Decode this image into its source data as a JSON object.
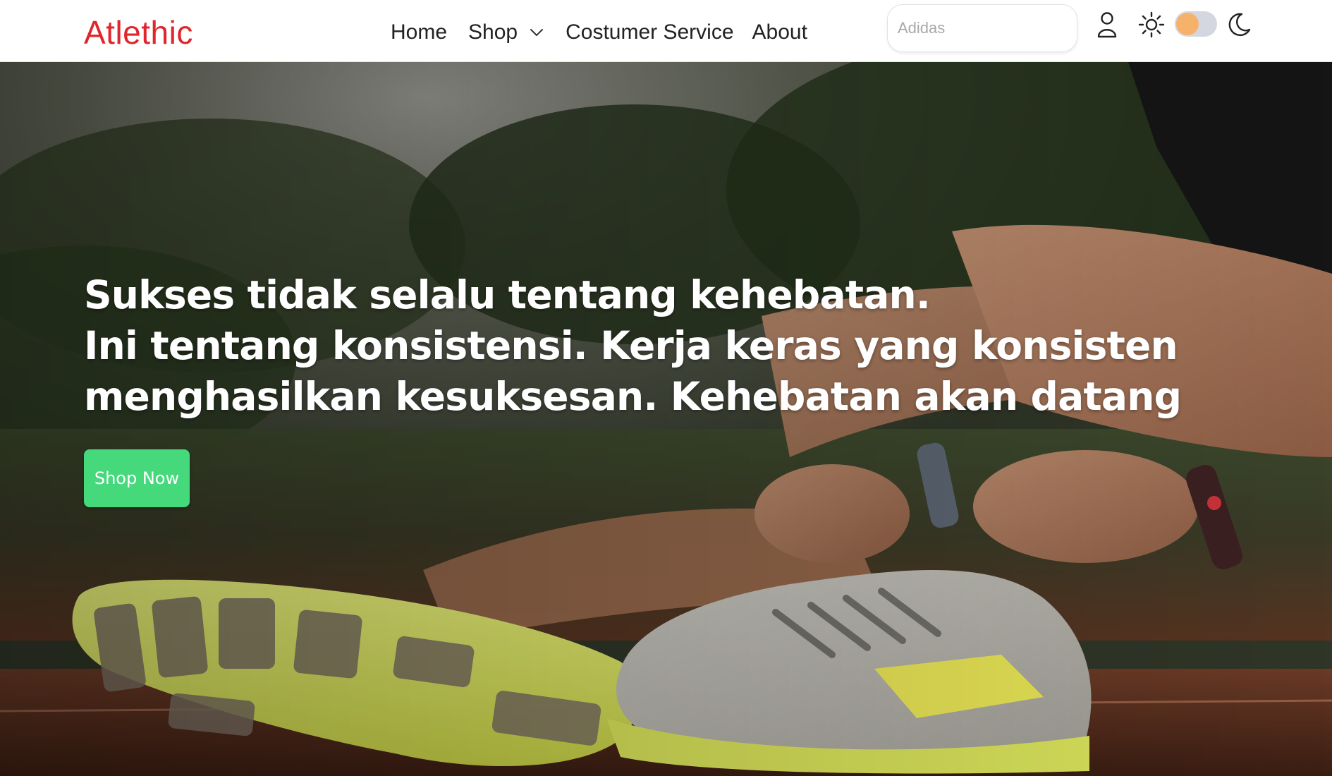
{
  "brand": {
    "name": "Atlethic",
    "color": "#e0262c"
  },
  "nav": {
    "home": "Home",
    "shop": "Shop",
    "customer_service": "Costumer Service",
    "about": "About"
  },
  "search": {
    "placeholder": "Adidas",
    "value": ""
  },
  "icons": {
    "user": "user-icon",
    "shop_dropdown": "chevron-down-icon",
    "light_mode": "sun-icon",
    "theme_toggle": "toggle-switch",
    "dark_mode": "moon-icon"
  },
  "theme": {
    "mode": "light",
    "toggle_knob_color": "#f6b26b",
    "toggle_track_color": "#d4d6e0"
  },
  "hero": {
    "headline": [
      "Sukses tidak selalu tentang kehebatan.",
      "Ini tentang konsistensi. Kerja keras yang konsisten",
      "menghasilkan kesuksesan. Kehebatan akan datang"
    ],
    "cta_label": "Shop Now",
    "cta_color": "#45d97c",
    "image": "runner tying shoelaces on a running track with yellow-soled running shoes"
  }
}
